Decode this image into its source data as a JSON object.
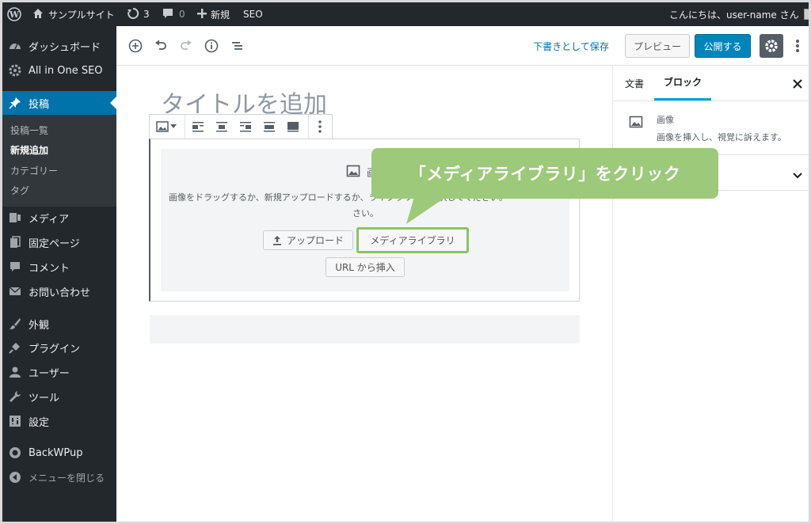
{
  "adminbar": {
    "site_name": "サンプルサイト",
    "updates_count": "3",
    "comments_count": "0",
    "new_label": "新規",
    "seo_label": "SEO",
    "greeting": "こんにちは、user-name さん"
  },
  "sidebar": {
    "items": [
      {
        "label": "ダッシュボード",
        "icon": "dashboard-icon"
      },
      {
        "label": "All in One SEO",
        "icon": "gear-icon"
      },
      {
        "label": "投稿",
        "icon": "pin-icon",
        "active": true
      },
      {
        "label": "メディア",
        "icon": "media-icon"
      },
      {
        "label": "固定ページ",
        "icon": "pages-icon"
      },
      {
        "label": "コメント",
        "icon": "comment-icon"
      },
      {
        "label": "お問い合わせ",
        "icon": "mail-icon"
      },
      {
        "label": "外観",
        "icon": "brush-icon"
      },
      {
        "label": "プラグイン",
        "icon": "plugin-icon"
      },
      {
        "label": "ユーザー",
        "icon": "user-icon"
      },
      {
        "label": "ツール",
        "icon": "wrench-icon"
      },
      {
        "label": "設定",
        "icon": "settings-icon"
      },
      {
        "label": "BackWPup",
        "icon": "backwpup-icon"
      }
    ],
    "submenu": [
      "投稿一覧",
      "新規追加",
      "カテゴリー",
      "タグ"
    ],
    "collapse_label": "メニューを閉じる"
  },
  "toolbar": {
    "save_draft": "下書きとして保存",
    "preview": "プレビュー",
    "publish": "公開する"
  },
  "panel": {
    "tab_document": "文書",
    "tab_block": "ブロック",
    "block_name": "画像",
    "block_description": "画像を挿入し、視覚に訴えます。"
  },
  "editor": {
    "title_placeholder": "タイトルを追加",
    "placeholder_label": "画",
    "instructions_line1": "画像をドラッグするか、新規アップロードするか、ライブラリから選択してください。",
    "instructions_line2": "さい。",
    "upload_button": "アップロード",
    "media_library_button": "メディアライブラリ",
    "insert_url_button": "URL から挿入"
  },
  "callout": {
    "text": "「メディアライブラリ」をクリック",
    "color": "#9dc97a"
  },
  "colors": {
    "adminbar_bg": "#23282d",
    "active_menu": "#0073aa",
    "publish_button": "#0085ba",
    "highlight_border": "#8dc16a"
  }
}
